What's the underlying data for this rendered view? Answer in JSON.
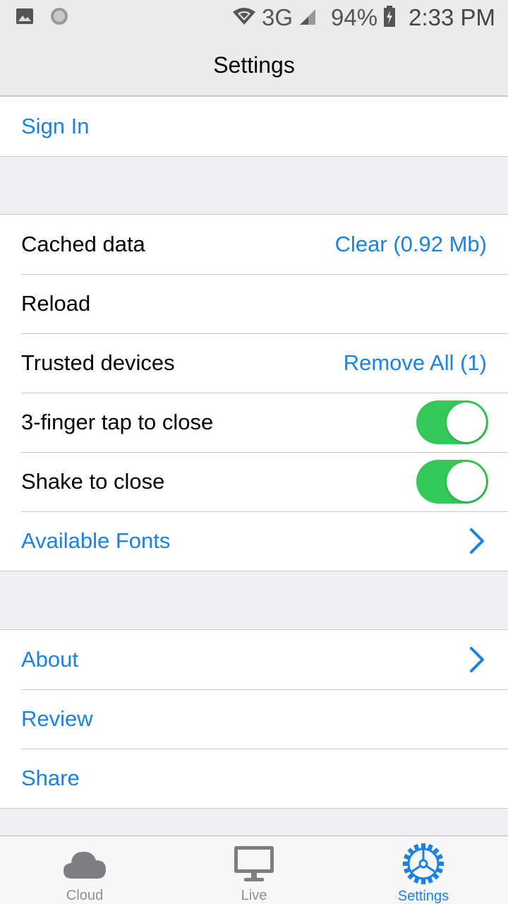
{
  "status_bar": {
    "network": "3G",
    "battery": "94%",
    "time": "2:33 PM"
  },
  "nav": {
    "title": "Settings"
  },
  "account": {
    "sign_in": "Sign In"
  },
  "general": {
    "cached_data": {
      "label": "Cached data",
      "action": "Clear (0.92 Mb)"
    },
    "reload": {
      "label": "Reload"
    },
    "trusted_devices": {
      "label": "Trusted devices",
      "action": "Remove All (1)"
    },
    "three_finger": {
      "label": "3-finger tap to close",
      "enabled": true
    },
    "shake": {
      "label": "Shake to close",
      "enabled": true
    },
    "fonts": {
      "label": "Available Fonts"
    }
  },
  "info": {
    "about": "About",
    "review": "Review",
    "share": "Share"
  },
  "tabs": [
    {
      "label": "Cloud",
      "icon": "cloud-icon",
      "active": false
    },
    {
      "label": "Live",
      "icon": "monitor-icon",
      "active": false
    },
    {
      "label": "Settings",
      "icon": "gear-icon",
      "active": true
    }
  ],
  "colors": {
    "accent": "#1a82e2",
    "toggle_on": "#34c759",
    "background": "#efeff4"
  }
}
